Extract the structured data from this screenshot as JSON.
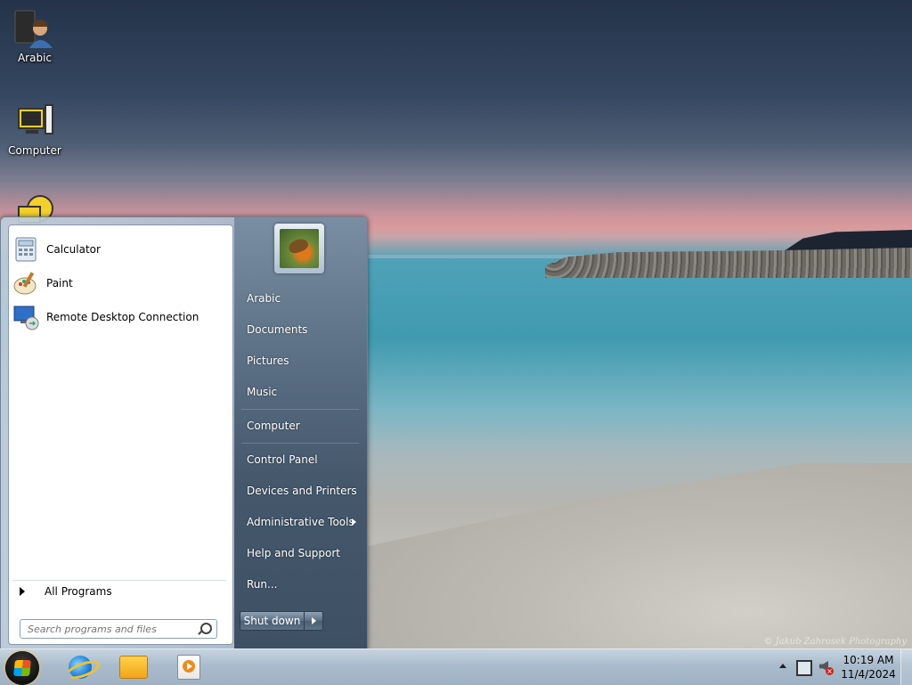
{
  "desktop": {
    "icons": [
      {
        "label": "Arabic",
        "icon": "user-folder-icon"
      },
      {
        "label": "Computer",
        "icon": "computer-icon"
      },
      {
        "label": "",
        "icon": "network-icon"
      }
    ],
    "watermark": "© Jakub Zahrosek Photography"
  },
  "start_menu": {
    "pinned_programs": [
      {
        "label": "Calculator",
        "icon": "calculator-icon"
      },
      {
        "label": "Paint",
        "icon": "paint-icon"
      },
      {
        "label": "Remote Desktop Connection",
        "icon": "remote-desktop-icon"
      }
    ],
    "all_programs_label": "All Programs",
    "search_placeholder": "Search programs and files",
    "right_items": [
      {
        "label": "Arabic"
      },
      {
        "label": "Documents"
      },
      {
        "label": "Pictures"
      },
      {
        "label": "Music"
      },
      {
        "label": "Computer"
      },
      {
        "label": "Control Panel"
      },
      {
        "label": "Devices and Printers"
      },
      {
        "label": "Administrative Tools",
        "has_submenu": true
      },
      {
        "label": "Help and Support"
      },
      {
        "label": "Run..."
      }
    ],
    "shutdown_label": "Shut down"
  },
  "taskbar": {
    "pinned": [
      "internet-explorer-icon",
      "windows-explorer-icon",
      "media-player-icon"
    ],
    "clock_time": "10:19 AM",
    "clock_date": "11/4/2024"
  }
}
